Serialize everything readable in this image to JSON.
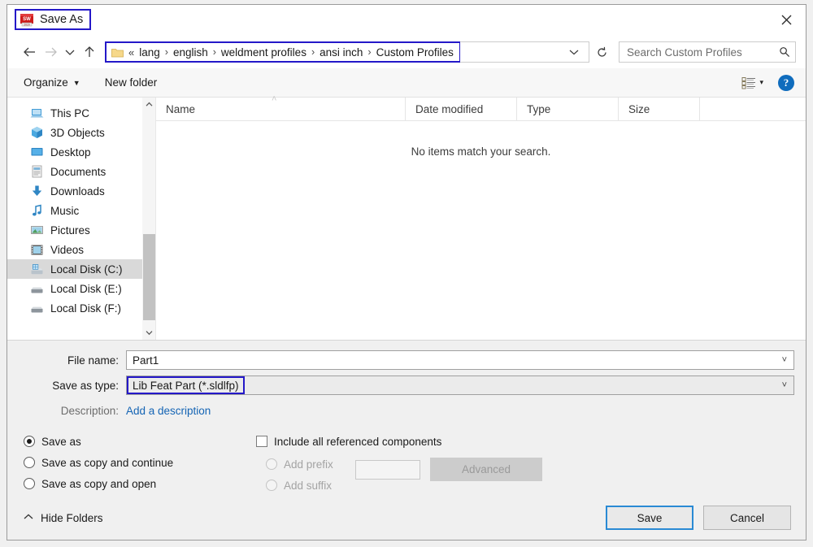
{
  "window": {
    "title": "Save As",
    "app_icon": "solidworks-icon",
    "close_label": "✕"
  },
  "address_bar": {
    "back_icon": "back-arrow-icon",
    "forward_icon": "forward-arrow-icon",
    "recent_icon": "chevron-down-icon",
    "up_icon": "up-arrow-icon",
    "folder_icon": "folder-icon",
    "overflow": "«",
    "crumbs": [
      "lang",
      "english",
      "weldment profiles",
      "ansi inch",
      "Custom Profiles"
    ],
    "separator": "›",
    "dropdown_icon": "chevron-down-icon",
    "refresh_icon": "refresh-icon",
    "search_placeholder": "Search Custom Profiles",
    "search_icon": "search-icon"
  },
  "command_bar": {
    "organize": "Organize",
    "new_folder": "New folder",
    "view_icon": "view-layout-icon",
    "view_caret": "▾",
    "help_label": "?"
  },
  "nav_pane": {
    "items": [
      {
        "label": "This PC",
        "icon": "computer-icon"
      },
      {
        "label": "3D Objects",
        "icon": "cube-icon"
      },
      {
        "label": "Desktop",
        "icon": "desktop-icon"
      },
      {
        "label": "Documents",
        "icon": "document-icon"
      },
      {
        "label": "Downloads",
        "icon": "download-arrow-icon"
      },
      {
        "label": "Music",
        "icon": "music-note-icon"
      },
      {
        "label": "Pictures",
        "icon": "picture-icon"
      },
      {
        "label": "Videos",
        "icon": "video-film-icon"
      },
      {
        "label": "Local Disk (C:)",
        "icon": "system-drive-icon",
        "selected": true
      },
      {
        "label": "Local Disk (E:)",
        "icon": "drive-icon"
      },
      {
        "label": "Local Disk (F:)",
        "icon": "drive-icon"
      }
    ],
    "scroll_up_icon": "chevron-up-icon",
    "scroll_down_icon": "chevron-down-icon"
  },
  "file_list": {
    "columns": [
      "Name",
      "Date modified",
      "Type",
      "Size"
    ],
    "sort_indicator": "˄",
    "rows": [],
    "empty_message": "No items match your search."
  },
  "form": {
    "file_name_label": "File name:",
    "file_name_value": "Part1",
    "save_as_type_label": "Save as type:",
    "save_as_type_value": "Lib Feat Part (*.sldlfp)",
    "description_label": "Description:",
    "description_link": "Add a description",
    "combo_caret": "˅"
  },
  "options": {
    "save_modes": [
      {
        "label": "Save as",
        "selected": true
      },
      {
        "label": "Save as copy and continue",
        "selected": false
      },
      {
        "label": "Save as copy and open",
        "selected": false
      }
    ],
    "include_refs": {
      "label": "Include all referenced components",
      "checked": false
    },
    "affix": [
      {
        "label": "Add prefix",
        "selected": false,
        "disabled": true
      },
      {
        "label": "Add suffix",
        "selected": false,
        "disabled": true
      }
    ],
    "affix_value": "",
    "advanced_label": "Advanced"
  },
  "footer": {
    "hide_folders_label": "Hide Folders",
    "hide_folders_icon": "chevron-up-icon",
    "save_label": "Save",
    "cancel_label": "Cancel"
  }
}
